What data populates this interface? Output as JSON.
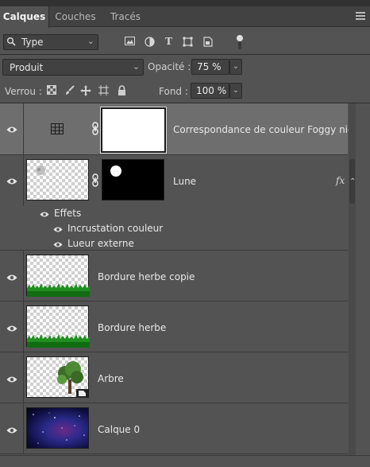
{
  "tabs": [
    {
      "label": "Calques",
      "active": true
    },
    {
      "label": "Couches",
      "active": false
    },
    {
      "label": "Tracés",
      "active": false
    }
  ],
  "filter": {
    "kind_label": "Type",
    "icons": [
      "image-filter-icon",
      "adjustment-filter-icon",
      "type-filter-icon",
      "shape-filter-icon",
      "smart-object-filter-icon"
    ]
  },
  "blend": {
    "mode": "Produit",
    "opacity_label": "Opacité :",
    "opacity_value": "75 %"
  },
  "lock": {
    "label": "Verrou :",
    "fill_label": "Fond :",
    "fill_value": "100 %"
  },
  "layers": [
    {
      "name": "Correspondance de couleur Foggy night",
      "type": "adjustment",
      "selected": true
    },
    {
      "name": "Lune",
      "type": "pixel-mask",
      "fx": "fx",
      "effects_label": "Effets",
      "effects": [
        "Incrustation couleur",
        "Lueur externe"
      ]
    },
    {
      "name": "Bordure herbe copie",
      "type": "grass"
    },
    {
      "name": "Bordure herbe",
      "type": "grass"
    },
    {
      "name": "Arbre",
      "type": "smart-object"
    },
    {
      "name": "Calque 0",
      "type": "space"
    }
  ],
  "colors": {
    "panel": "#535353",
    "selected": "#6e6e6e",
    "tabbar": "#424242"
  }
}
